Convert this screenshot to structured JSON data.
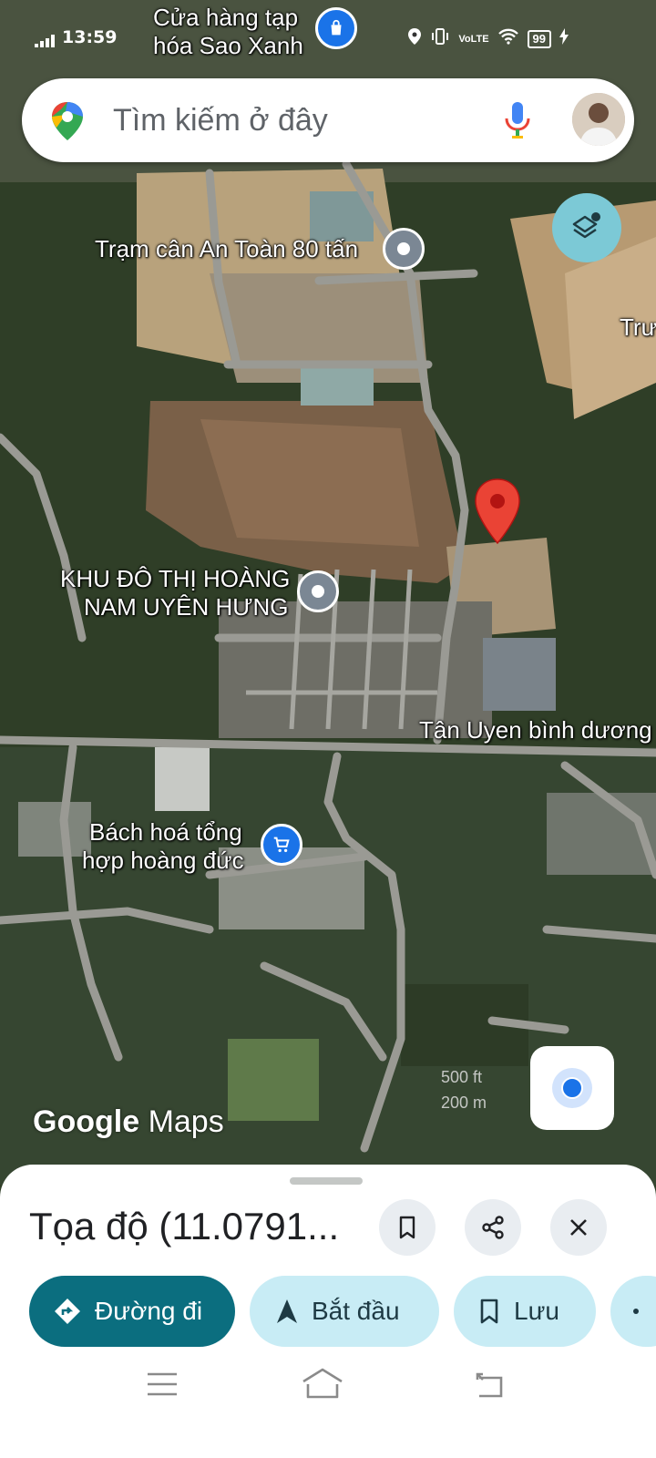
{
  "status_bar": {
    "time": "13:59",
    "network": "VoLTE",
    "battery": "99"
  },
  "search": {
    "placeholder": "Tìm kiếm ở đây"
  },
  "map": {
    "labels": {
      "shop": [
        "Cửa hàng tạp",
        "hóa Sao Xanh"
      ],
      "scale_station": "Trạm cân An Toàn 80 tấn",
      "edge_partial": "Trư",
      "urban_area": [
        "KHU ĐÔ THỊ HOÀNG",
        "NAM UYÊN HƯNG"
      ],
      "road": "Tân Uyen bình dương",
      "grocery": [
        "Bách hoá tổng",
        "hợp hoàng đức"
      ]
    },
    "watermark": {
      "brand": "Google",
      "product": "Maps"
    },
    "scale": {
      "top": "500 ft",
      "bottom": "200 m"
    }
  },
  "sheet": {
    "title": "Tọa độ (11.0791...",
    "actions": {
      "directions": "Đường đi",
      "start": "Bắt đầu",
      "save": "Lưu"
    }
  },
  "colors": {
    "accent": "#0b6e7f",
    "chip_bg": "#c8ecf5",
    "pin": "#ea4335",
    "poi_blue": "#1a73e8",
    "poi_gray": "#7b8794"
  }
}
